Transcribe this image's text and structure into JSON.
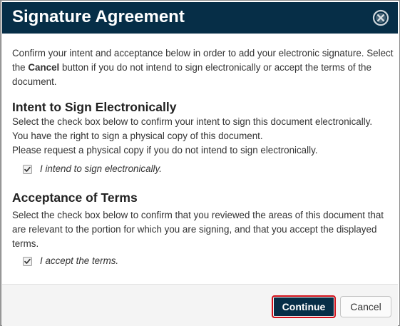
{
  "dialog": {
    "title": "Signature Agreement",
    "close_icon": "close-circle-icon",
    "intro": {
      "part1": "Confirm your intent and acceptance below in order to add your electronic signature. Select the ",
      "bold": "Cancel",
      "part2": " button if you do not intend to sign electronically or accept the terms of the document."
    },
    "intent": {
      "heading": "Intent to Sign Electronically",
      "line1": "Select the check box below to confirm your intent to sign this document electronically.",
      "line2": "You have the right to sign a physical copy of this document.",
      "line3": "Please request a physical copy if you do not intend to sign electronically.",
      "checkbox_label": "I intend to sign electronically.",
      "checked": true
    },
    "terms": {
      "heading": "Acceptance of Terms",
      "text": "Select the check box below to confirm that you reviewed the areas of this document that are relevant to the portion for which you are signing, and that you accept the displayed terms.",
      "checkbox_label": "I accept the terms.",
      "checked": true
    },
    "footer": {
      "continue_label": "Continue",
      "cancel_label": "Cancel"
    },
    "colors": {
      "header_bg": "#062e47",
      "primary_button_bg": "#062e47",
      "focus_border": "#d0101a"
    }
  }
}
